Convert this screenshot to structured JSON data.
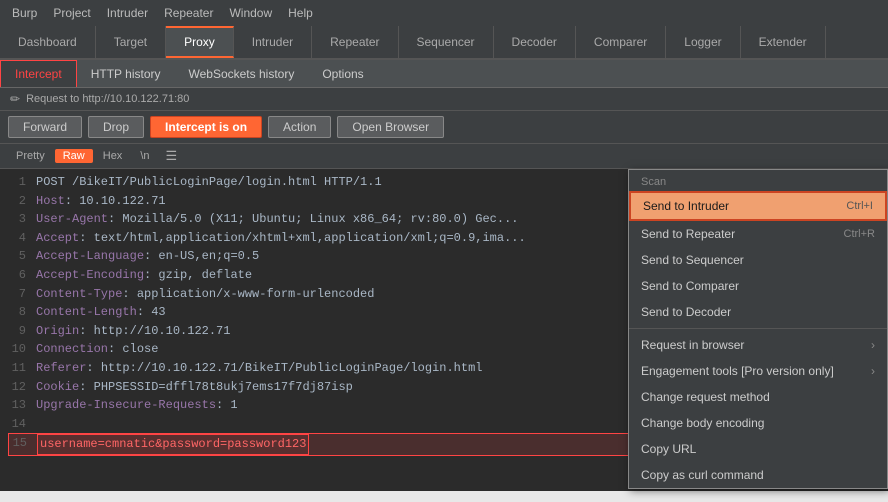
{
  "menuBar": {
    "items": [
      "Burp",
      "Project",
      "Intruder",
      "Repeater",
      "Window",
      "Help"
    ]
  },
  "topTabs": {
    "items": [
      "Dashboard",
      "Target",
      "Proxy",
      "Intruder",
      "Repeater",
      "Sequencer",
      "Decoder",
      "Comparer",
      "Logger",
      "Extender"
    ],
    "activeIndex": 2
  },
  "subTabs": {
    "items": [
      "Intercept",
      "HTTP history",
      "WebSockets history",
      "Options"
    ],
    "activeIndex": 0
  },
  "requestInfo": {
    "label": "Request to http://10.10.122.71:80"
  },
  "toolbar": {
    "forward": "Forward",
    "drop": "Drop",
    "intercept": "Intercept is on",
    "action": "Action",
    "openBrowser": "Open Browser"
  },
  "viewSelector": {
    "items": [
      "Pretty",
      "Raw",
      "Hex",
      "\\n"
    ],
    "activeIndex": 1
  },
  "codeLines": [
    {
      "num": 1,
      "text": "POST /BikeIT/PublicLoginPage/login.html HTTP/1.1"
    },
    {
      "num": 2,
      "text": "Host: 10.10.122.71"
    },
    {
      "num": 3,
      "text": "User-Agent: Mozilla/5.0 (X11; Ubuntu; Linux x86_64; rv:80.0) Gec..."
    },
    {
      "num": 4,
      "text": "Accept: text/html,application/xhtml+xml,application/xml;q=0.9,ima..."
    },
    {
      "num": 5,
      "text": "Accept-Language: en-US,en;q=0.5"
    },
    {
      "num": 6,
      "text": "Accept-Encoding: gzip, deflate"
    },
    {
      "num": 7,
      "text": "Content-Type: application/x-www-form-urlencoded"
    },
    {
      "num": 8,
      "text": "Content-Length: 43"
    },
    {
      "num": 9,
      "text": "Origin: http://10.10.122.71"
    },
    {
      "num": 10,
      "text": "Connection: close"
    },
    {
      "num": 11,
      "text": "Referer: http://10.10.122.71/BikeIT/PublicLoginPage/login.html"
    },
    {
      "num": 12,
      "text": "Cookie: PHPSESSID=dffl78t8ukj7ems17f7dj87isp"
    },
    {
      "num": 13,
      "text": "Upgrade-Insecure-Requests: 1"
    },
    {
      "num": 14,
      "text": ""
    },
    {
      "num": 15,
      "text": "username=cmnatic&password=password123",
      "highlight": true
    }
  ],
  "contextMenu": {
    "scanLabel": "Scan",
    "items": [
      {
        "label": "Send to Intruder",
        "shortcut": "Ctrl+I",
        "highlighted": true,
        "arrow": false
      },
      {
        "label": "Send to Repeater",
        "shortcut": "Ctrl+R",
        "highlighted": false,
        "arrow": false
      },
      {
        "label": "Send to Sequencer",
        "shortcut": "",
        "highlighted": false,
        "arrow": false
      },
      {
        "label": "Send to Comparer",
        "shortcut": "",
        "highlighted": false,
        "arrow": false
      },
      {
        "label": "Send to Decoder",
        "shortcut": "",
        "highlighted": false,
        "arrow": false
      },
      {
        "label": "Request in browser",
        "shortcut": "",
        "highlighted": false,
        "arrow": true
      },
      {
        "label": "Engagement tools [Pro version only]",
        "shortcut": "",
        "highlighted": false,
        "arrow": true
      },
      {
        "label": "Change request method",
        "shortcut": "",
        "highlighted": false,
        "arrow": false
      },
      {
        "label": "Change body encoding",
        "shortcut": "",
        "highlighted": false,
        "arrow": false
      },
      {
        "label": "Copy URL",
        "shortcut": "",
        "highlighted": false,
        "arrow": false
      },
      {
        "label": "Copy as curl command",
        "shortcut": "",
        "highlighted": false,
        "arrow": false
      }
    ]
  }
}
